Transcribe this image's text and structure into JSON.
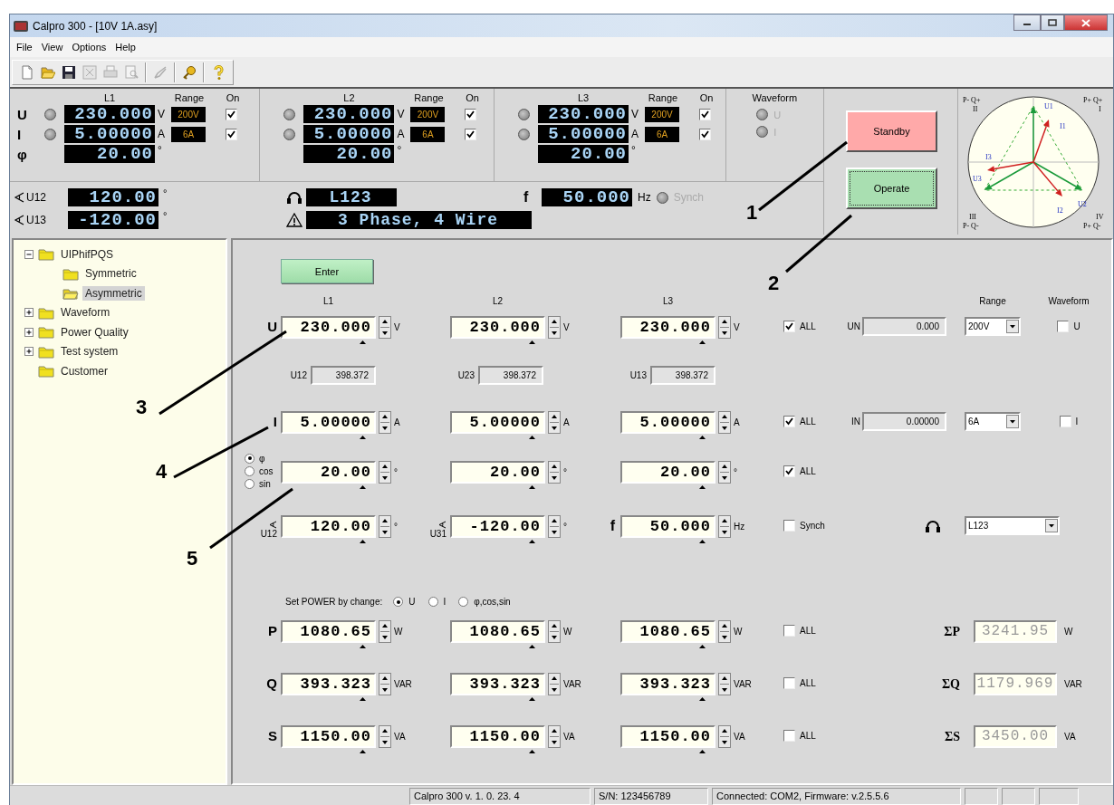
{
  "window": {
    "title": "Calpro 300 - [10V 1A.asy]",
    "menu": [
      "File",
      "View",
      "Options",
      "Help"
    ]
  },
  "toolbar": [
    {
      "kind": "new",
      "disabled": false
    },
    {
      "kind": "open",
      "disabled": false
    },
    {
      "kind": "save",
      "disabled": false
    },
    {
      "kind": "export",
      "disabled": true
    },
    {
      "kind": "print",
      "disabled": true
    },
    {
      "kind": "preview",
      "disabled": true
    },
    {
      "kind": "separator"
    },
    {
      "kind": "tool",
      "disabled": true
    },
    {
      "kind": "separator"
    },
    {
      "kind": "key",
      "disabled": false
    },
    {
      "kind": "separator"
    },
    {
      "kind": "help",
      "disabled": false
    }
  ],
  "meter": {
    "row_labels": [
      "U",
      "I",
      "φ"
    ],
    "phases": [
      {
        "title": "L1",
        "range_header": "Range",
        "on_header": "On",
        "u": {
          "value": "230.000",
          "unit": "V",
          "range": "200V",
          "on": true
        },
        "i": {
          "value": "5.00000",
          "unit": "A",
          "range": "6A",
          "on": true
        },
        "phi": {
          "value": "20.00",
          "unit": "°"
        }
      },
      {
        "title": "L2",
        "range_header": "Range",
        "on_header": "On",
        "u": {
          "value": "230.000",
          "unit": "V",
          "range": "200V",
          "on": true
        },
        "i": {
          "value": "5.00000",
          "unit": "A",
          "range": "6A",
          "on": true
        },
        "phi": {
          "value": "20.00",
          "unit": "°"
        }
      },
      {
        "title": "L3",
        "range_header": "Range",
        "on_header": "On",
        "u": {
          "value": "230.000",
          "unit": "V",
          "range": "200V",
          "on": true
        },
        "i": {
          "value": "5.00000",
          "unit": "A",
          "range": "6A",
          "on": true
        },
        "phi": {
          "value": "20.00",
          "unit": "°"
        }
      }
    ],
    "waveform": {
      "title": "Waveform",
      "lamps": [
        {
          "label": "U",
          "disabled": true
        },
        {
          "label": "I",
          "disabled": true
        }
      ]
    },
    "angles": [
      {
        "label": "U12",
        "value": "120.00",
        "unit": "°"
      },
      {
        "label": "U13",
        "value": "-120.00",
        "unit": "°"
      }
    ],
    "channel": "L123",
    "wiring": "3 Phase, 4 Wire",
    "frequency": {
      "label": "f",
      "value": "50.000",
      "unit": "Hz",
      "synch": {
        "label": "Synch",
        "disabled": true
      }
    }
  },
  "buttons": [
    {
      "label": "Standby",
      "kind": "standby"
    },
    {
      "label": "Operate",
      "kind": "operate"
    }
  ],
  "phasor": {
    "labels": [
      "P- Q+",
      "II",
      "P+ Q+",
      "I",
      "III",
      "P- Q-",
      "IV",
      "P+ Q-",
      "U1",
      "I1",
      "I3",
      "U3",
      "I2",
      "U2"
    ]
  },
  "tree": [
    {
      "label": "UIPhifPQS",
      "expanded": true,
      "selected": false,
      "children": [
        {
          "label": "Symmetric",
          "selected": false
        },
        {
          "label": "Asymmetric",
          "selected": true
        }
      ]
    },
    {
      "label": "Waveform",
      "expanded": false,
      "selected": false
    },
    {
      "label": "Power Quality",
      "expanded": false,
      "selected": false
    },
    {
      "label": "Test system",
      "expanded": false,
      "selected": false
    },
    {
      "label": "Customer",
      "selected": false
    }
  ],
  "form": {
    "enter": "Enter",
    "columns": [
      "L1",
      "L2",
      "L3"
    ],
    "range_header": "Range",
    "waveform_header": "Waveform",
    "rows": [
      {
        "kind": "quantity",
        "label": "U",
        "cells": [
          {
            "value": "230.000",
            "unit": "V"
          },
          {
            "value": "230.000",
            "unit": "V"
          },
          {
            "value": "230.000",
            "unit": "V"
          }
        ],
        "all": {
          "label": "ALL",
          "checked": true
        },
        "neutral": {
          "label": "UN",
          "value": "0.000"
        },
        "range": "200V",
        "waveform": {
          "label": "U",
          "checked": false
        }
      },
      {
        "kind": "line",
        "cells": [
          {
            "label": "U12",
            "value": "398.372"
          },
          {
            "label": "U23",
            "value": "398.372"
          },
          {
            "label": "U13",
            "value": "398.372"
          }
        ]
      },
      {
        "kind": "quantity",
        "label": "I",
        "cells": [
          {
            "value": "5.00000",
            "unit": "A"
          },
          {
            "value": "5.00000",
            "unit": "A"
          },
          {
            "value": "5.00000",
            "unit": "A"
          }
        ],
        "all": {
          "label": "ALL",
          "checked": true
        },
        "neutral": {
          "label": "IN",
          "value": "0.00000"
        },
        "range": "6A",
        "waveform": {
          "label": "I",
          "checked": false
        }
      },
      {
        "kind": "phase",
        "modes": [
          {
            "label": "φ",
            "selected": true
          },
          {
            "label": "cos",
            "selected": false
          },
          {
            "label": "sin",
            "selected": false
          }
        ],
        "cells": [
          {
            "value": "20.00",
            "unit": "°"
          },
          {
            "value": "20.00",
            "unit": "°"
          },
          {
            "value": "20.00",
            "unit": "°"
          }
        ],
        "all": {
          "label": "ALL",
          "checked": true
        }
      },
      {
        "kind": "angle",
        "cells": [
          {
            "label": "U12",
            "value": "120.00",
            "unit": "°"
          },
          {
            "label": "U31",
            "value": "-120.00",
            "unit": "°"
          }
        ],
        "frequency": {
          "label": "f",
          "value": "50.000",
          "unit": "Hz"
        },
        "synch": {
          "label": "Synch",
          "checked": false
        },
        "channel": "L123"
      },
      {
        "kind": "choice",
        "label": "Set POWER by change:",
        "options": [
          {
            "label": "U",
            "selected": true
          },
          {
            "label": "I",
            "selected": false
          },
          {
            "label": "φ,cos,sin",
            "selected": false
          }
        ]
      },
      {
        "kind": "power",
        "label": "P",
        "cells": [
          {
            "value": "1080.65",
            "unit": "W"
          },
          {
            "value": "1080.65",
            "unit": "W"
          },
          {
            "value": "1080.65",
            "unit": "W"
          }
        ],
        "all": {
          "label": "ALL",
          "checked": false
        },
        "sum": {
          "label": "ΣP",
          "value": "3241.95",
          "unit": "W"
        }
      },
      {
        "kind": "power",
        "label": "Q",
        "cells": [
          {
            "value": "393.323",
            "unit": "VAR"
          },
          {
            "value": "393.323",
            "unit": "VAR"
          },
          {
            "value": "393.323",
            "unit": "VAR"
          }
        ],
        "all": {
          "label": "ALL",
          "checked": false
        },
        "sum": {
          "label": "ΣQ",
          "value": "1179.969",
          "unit": "VAR"
        }
      },
      {
        "kind": "power",
        "label": "S",
        "cells": [
          {
            "value": "1150.00",
            "unit": "VA"
          },
          {
            "value": "1150.00",
            "unit": "VA"
          },
          {
            "value": "1150.00",
            "unit": "VA"
          }
        ],
        "all": {
          "label": "ALL",
          "checked": false
        },
        "sum": {
          "label": "ΣS",
          "value": "3450.00",
          "unit": "VA"
        }
      }
    ]
  },
  "status_bar": [
    "Calpro 300 v. 1. 0. 23. 4",
    "S/N: 123456789",
    "Connected: COM2,  Firmware: v.2.5.5.6"
  ],
  "annotations": [
    "1",
    "2",
    "3",
    "4",
    "5"
  ]
}
